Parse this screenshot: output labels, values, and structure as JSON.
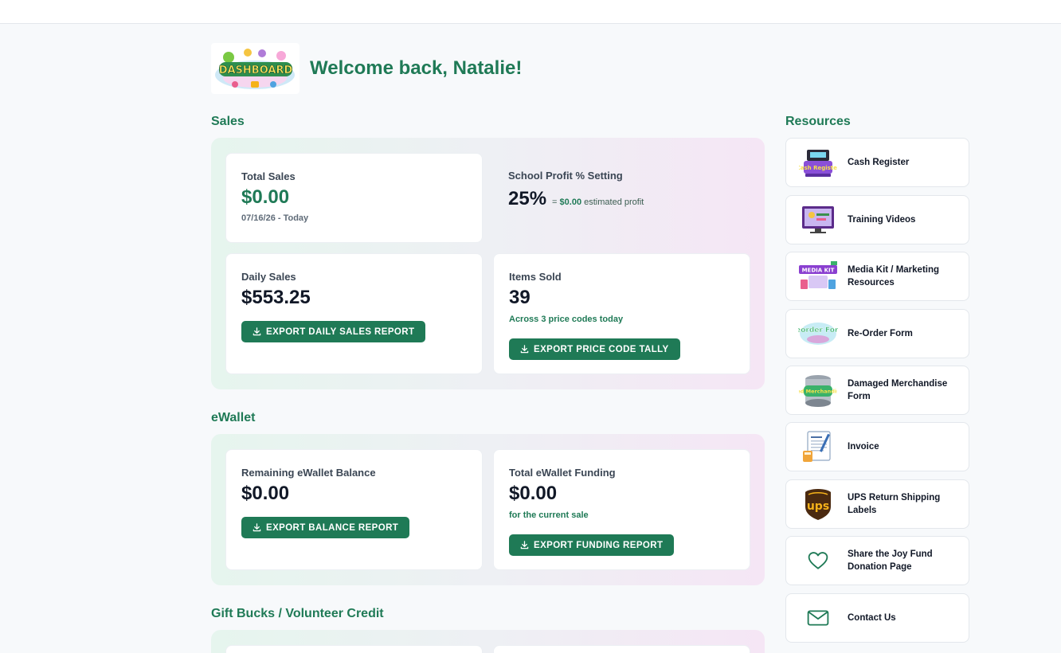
{
  "header": {
    "logo_text": "DASHBOARD",
    "welcome": "Welcome back, Natalie!"
  },
  "sales": {
    "title": "Sales",
    "total_sales": {
      "label": "Total Sales",
      "value": "$0.00",
      "range": "07/16/26 - Today"
    },
    "profit": {
      "label": "School Profit % Setting",
      "percent": "25%",
      "prefix": "= ",
      "amount": "$0.00",
      "suffix": " estimated profit"
    },
    "daily": {
      "label": "Daily Sales",
      "value": "$553.25",
      "button": "EXPORT DAILY SALES REPORT"
    },
    "items": {
      "label": "Items Sold",
      "value": "39",
      "note": "Across 3 price codes today",
      "button": "EXPORT PRICE CODE TALLY"
    }
  },
  "ewallet": {
    "title": "eWallet",
    "balance": {
      "label": "Remaining eWallet Balance",
      "value": "$0.00",
      "button": "EXPORT BALANCE REPORT"
    },
    "funding": {
      "label": "Total eWallet Funding",
      "value": "$0.00",
      "note": "for the current sale",
      "button": "EXPORT FUNDING REPORT"
    }
  },
  "gift": {
    "title": "Gift Bucks / Volunteer Credit"
  },
  "resources": {
    "title": "Resources",
    "items": [
      {
        "label": "Cash Register",
        "icon": "cash-register-icon"
      },
      {
        "label": "Training Videos",
        "icon": "training-videos-icon"
      },
      {
        "label": "Media Kit / Marketing Resources",
        "icon": "media-kit-icon"
      },
      {
        "label": "Re-Order Form",
        "icon": "reorder-form-icon"
      },
      {
        "label": "Damaged Merchandise Form",
        "icon": "damaged-merchandise-icon"
      },
      {
        "label": "Invoice",
        "icon": "invoice-icon"
      },
      {
        "label": "UPS Return Shipping Labels",
        "icon": "ups-icon"
      },
      {
        "label": "Share the Joy Fund Donation Page",
        "icon": "heart-icon"
      },
      {
        "label": "Contact Us",
        "icon": "mail-icon"
      }
    ],
    "thumb_texts": {
      "cash": "Cash Register",
      "media": "MEDIA KIT",
      "reorder": "Reorder Form",
      "damaged": "Damaged Merchandise Form",
      "ups": "ups"
    }
  },
  "colors": {
    "brand": "#1f7a56",
    "ups_brown": "#4b2a10",
    "ups_gold": "#f5b21a"
  }
}
